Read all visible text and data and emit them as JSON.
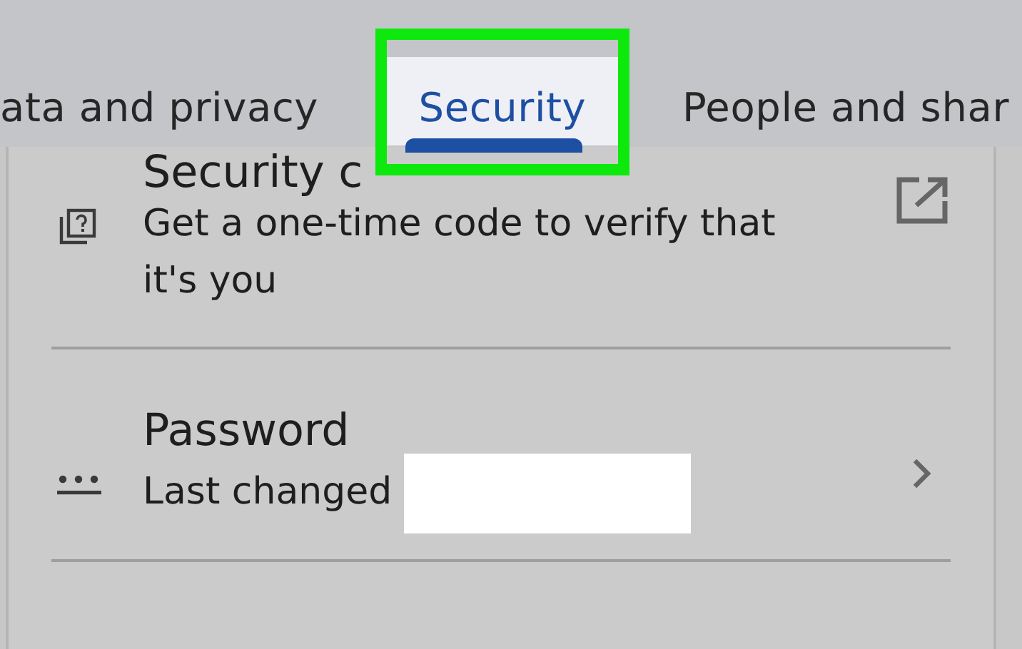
{
  "tabs": [
    {
      "label": "ata and privacy",
      "selected": false
    },
    {
      "label": "Security",
      "selected": true
    },
    {
      "label": "People and shar",
      "selected": false
    }
  ],
  "items": [
    {
      "kind": "external",
      "title": "Security c",
      "description": "Get a one-time code to verify that it's you"
    },
    {
      "kind": "chevron",
      "title": "Password",
      "description": "Last changed",
      "redacted": true
    }
  ]
}
